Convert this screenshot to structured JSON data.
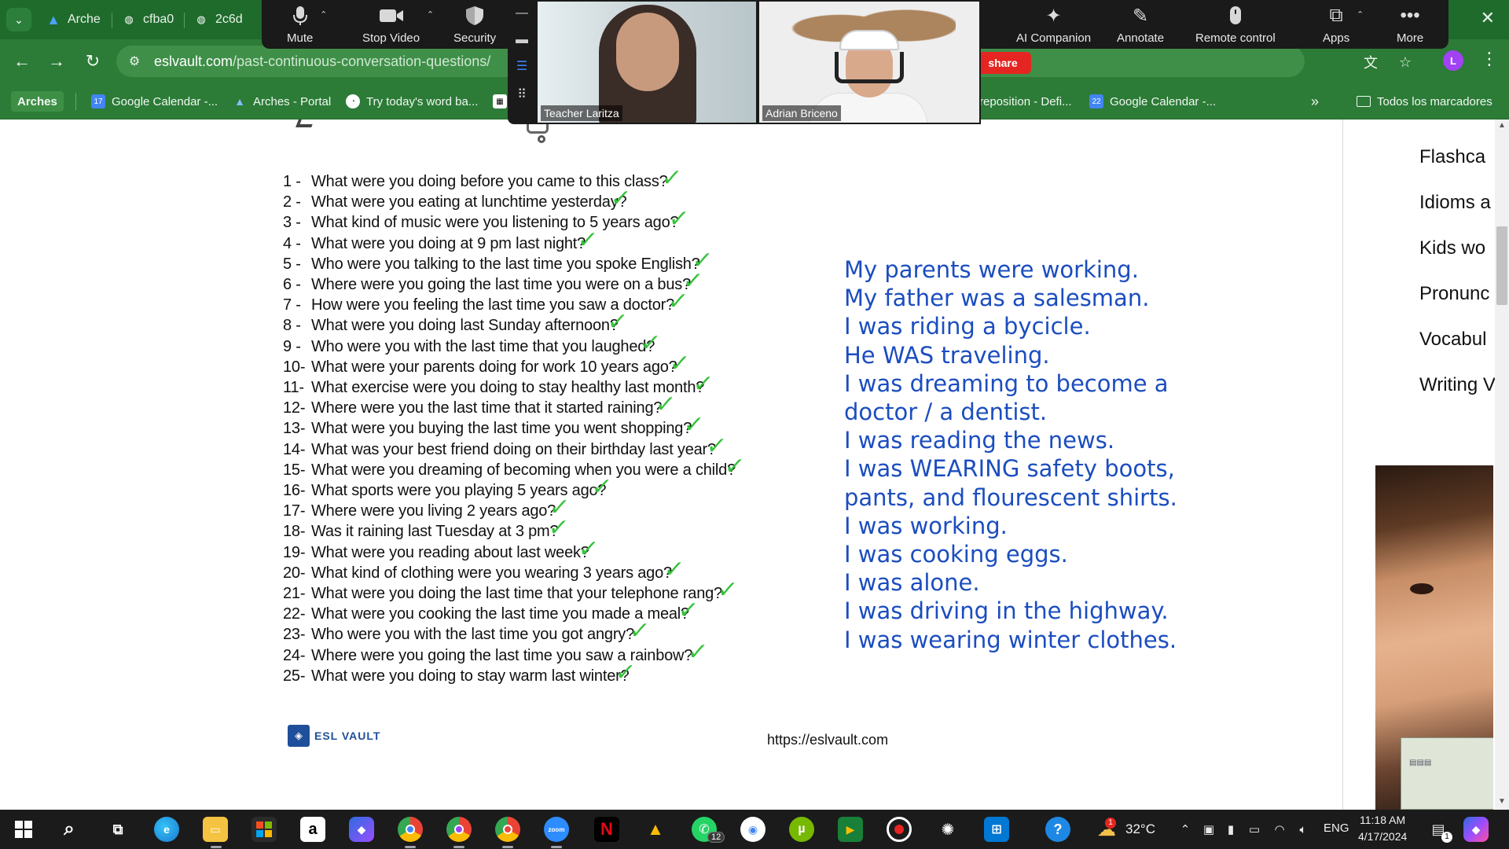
{
  "browser": {
    "tabs": [
      {
        "label": "Arche",
        "icon": "arches-icon"
      },
      {
        "label": "cfba0",
        "icon": "globe-icon"
      },
      {
        "label": "2c6d",
        "icon": "globe-icon"
      }
    ],
    "url_host": "eslvault.com",
    "url_path": "/past-continuous-conversation-questions/",
    "profile_initial": "L",
    "share_label": "share",
    "bookmarks": [
      {
        "label": "Arches"
      },
      {
        "label": "Google Calendar -..."
      },
      {
        "label": "Arches - Portal"
      },
      {
        "label": "Try today's word ba..."
      },
      {
        "label": "reposition - Defi..."
      },
      {
        "label": "Google Calendar -..."
      }
    ],
    "all_bookmarks_label": "Todos los marcadores",
    "calendar_day_1": "17",
    "calendar_day_2": "22"
  },
  "zoom": {
    "controls": [
      {
        "label": "Mute",
        "icon": "microphone-icon"
      },
      {
        "label": "Stop Video",
        "icon": "video-camera-icon"
      },
      {
        "label": "Security",
        "icon": "shield-icon"
      },
      {
        "label": "AI Companion",
        "icon": "sparkle-icon"
      },
      {
        "label": "Annotate",
        "icon": "pencil-icon"
      },
      {
        "label": "Remote control",
        "icon": "mouse-icon"
      },
      {
        "label": "Apps",
        "icon": "apps-icon"
      },
      {
        "label": "More",
        "icon": "more-dots-icon"
      }
    ],
    "participants": [
      {
        "name": "Teacher Laritza"
      },
      {
        "name": "Adrian Briceno"
      }
    ]
  },
  "worksheet": {
    "questions": [
      {
        "num": "1 -",
        "text": "What were you doing before you came to this class?"
      },
      {
        "num": "2 -",
        "text": "What were you eating at lunchtime yesterday?"
      },
      {
        "num": "3 -",
        "text": "What kind of music were you listening to 5 years ago?"
      },
      {
        "num": "4 -",
        "text": "What were you doing at 9 pm last night?"
      },
      {
        "num": "5 -",
        "text": "Who were you talking to the last time you spoke English?"
      },
      {
        "num": "6 -",
        "text": "Where were you going the last time you were on a bus?"
      },
      {
        "num": "7 -",
        "text": "How were you feeling the last time you saw a doctor?"
      },
      {
        "num": "8 -",
        "text": "What were you doing last Sunday afternoon?"
      },
      {
        "num": "9 -",
        "text": "Who were you with the last time that you laughed?"
      },
      {
        "num": "10-",
        "text": "What were your parents doing for work 10 years ago?"
      },
      {
        "num": "11-",
        "text": "What exercise were you doing to stay healthy last month?"
      },
      {
        "num": "12-",
        "text": "Where were you the last time that it started raining?"
      },
      {
        "num": "13-",
        "text": "What were you buying the last time you went shopping?"
      },
      {
        "num": "14-",
        "text": "What was your best friend doing on their birthday last year?"
      },
      {
        "num": "15-",
        "text": "What were you dreaming of becoming when you were a child?"
      },
      {
        "num": "16-",
        "text": "What sports were you playing 5 years ago?"
      },
      {
        "num": "17-",
        "text": "Where were you living 2 years ago?"
      },
      {
        "num": "18-",
        "text": "Was it raining last Tuesday at 3 pm?"
      },
      {
        "num": "19-",
        "text": "What were you reading about last week?"
      },
      {
        "num": "20-",
        "text": "What kind of clothing were you wearing 3 years ago?"
      },
      {
        "num": "21-",
        "text": "What were you doing the last time that your telephone rang?"
      },
      {
        "num": "22-",
        "text": "What were you cooking the last time you made a meal?"
      },
      {
        "num": "23-",
        "text": "Who were you with the last time you got angry?"
      },
      {
        "num": "24-",
        "text": "Where were you going the last time you saw a rainbow?"
      },
      {
        "num": "25-",
        "text": "What were you doing to stay warm last winter?"
      }
    ],
    "check_mark": "✓",
    "answers": [
      "My parents were working.",
      "My father was a salesman.",
      "I was riding a bycicle.",
      "He WAS traveling.",
      "I was dreaming to become a",
      "doctor / a dentist.",
      "I was reading the news.",
      "I was WEARING safety boots,",
      "pants, and flourescent shirts.",
      "I was working.",
      "I was cooking eggs.",
      "I was alone.",
      "I was driving in the highway.",
      "I was wearing winter clothes."
    ],
    "answer_color": "#1b4dbf",
    "logo_text": "ESL VAULT",
    "site_link": "https://eslvault.com"
  },
  "site_sidebar": {
    "items": [
      "Flashca",
      "Idioms a",
      "Kids wo",
      "Pronunc",
      "Vocabul",
      "Writing V"
    ]
  },
  "taskbar": {
    "whatsapp_badge": "12",
    "temperature": "32°C",
    "language": "ENG",
    "time": "11:18 AM",
    "date": "4/17/2024",
    "notification_count": "1",
    "weather_badge": "1"
  }
}
